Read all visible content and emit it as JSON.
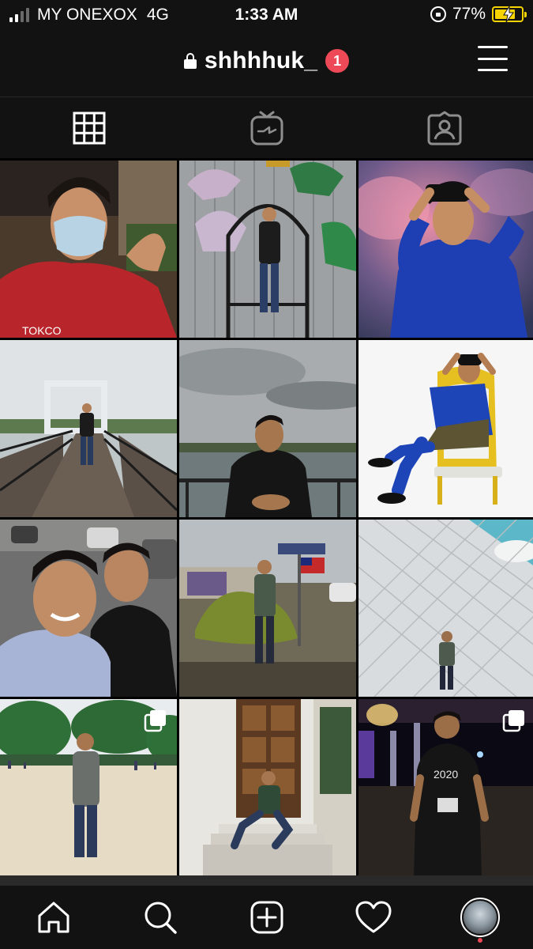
{
  "status_bar": {
    "carrier": "MY ONEXOX",
    "network": "4G",
    "time": "1:33 AM",
    "battery": "77%",
    "battery_level": 0.77,
    "signal_bars_filled": 2,
    "signal_bars_total": 4,
    "battery_color": "#f5d400"
  },
  "header": {
    "username": "shhhhuk_",
    "notification_count": "1",
    "icons": {
      "lock": "padlock-icon",
      "menu": "hamburger-menu-icon"
    }
  },
  "tabs": [
    {
      "name": "grid",
      "icon": "grid-icon",
      "active": true
    },
    {
      "name": "igtv",
      "icon": "igtv-icon",
      "active": false
    },
    {
      "name": "tagged",
      "icon": "tagged-person-icon",
      "active": false
    }
  ],
  "posts": [
    {
      "id": "post-1",
      "multi": false
    },
    {
      "id": "post-2",
      "multi": false
    },
    {
      "id": "post-3",
      "multi": false
    },
    {
      "id": "post-4",
      "multi": false
    },
    {
      "id": "post-5",
      "multi": false
    },
    {
      "id": "post-6",
      "multi": false
    },
    {
      "id": "post-7",
      "multi": false
    },
    {
      "id": "post-8",
      "multi": false
    },
    {
      "id": "post-9",
      "multi": false
    },
    {
      "id": "post-10",
      "multi": true
    },
    {
      "id": "post-11",
      "multi": false
    },
    {
      "id": "post-12",
      "multi": true
    }
  ],
  "bottom_nav": [
    {
      "name": "home",
      "icon": "home-icon"
    },
    {
      "name": "search",
      "icon": "search-icon"
    },
    {
      "name": "new-post",
      "icon": "plus-square-icon"
    },
    {
      "name": "activity",
      "icon": "heart-icon"
    },
    {
      "name": "profile",
      "icon": "avatar"
    }
  ],
  "colors": {
    "background": "#000000",
    "bar": "#121212",
    "badge": "#ed4956"
  }
}
